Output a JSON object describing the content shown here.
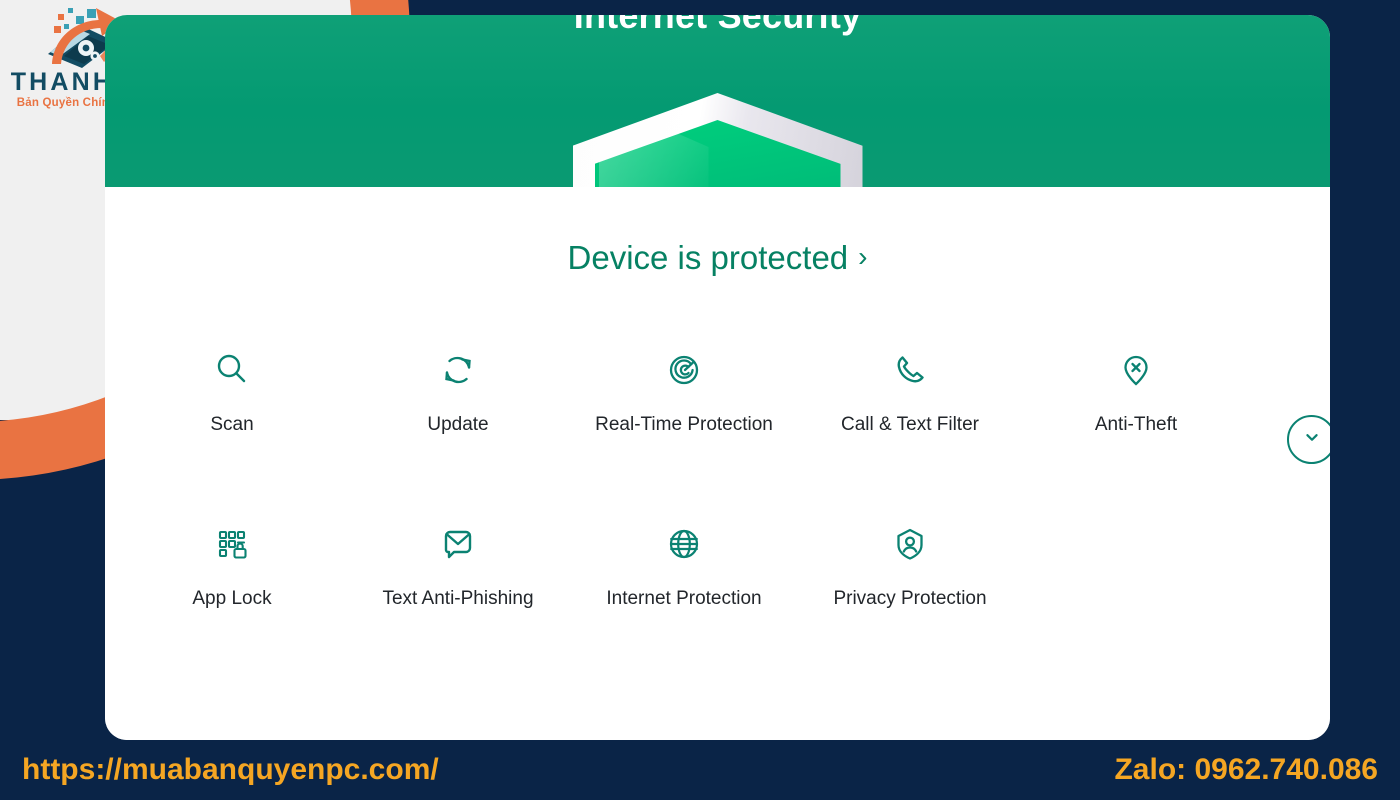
{
  "brand": {
    "logo_wordmark": "THANHPC",
    "logo_tagline": "Bản Quyền Chính Hãng",
    "logo_icon": "laptop-gear-arrow-icon",
    "colors": {
      "orange": "#e97342",
      "teal_dark": "#124c63",
      "navy": "#0a2447",
      "green": "#049a72",
      "amber": "#f5a623",
      "icon_teal": "#0b8272",
      "status_green": "#068163"
    }
  },
  "app": {
    "title": "Internet Security",
    "shield_icon": "shield-graphic",
    "status": {
      "label": "Device is protected",
      "chevron": "›"
    },
    "expand_button": {
      "icon": "chevron-down-icon"
    },
    "features": [
      {
        "label": "Scan",
        "icon": "magnifier-icon"
      },
      {
        "label": "Update",
        "icon": "refresh-icon"
      },
      {
        "label": "Real-Time Protection",
        "icon": "radar-target-icon"
      },
      {
        "label": "Call & Text Filter",
        "icon": "phone-icon"
      },
      {
        "label": "Anti-Theft",
        "icon": "map-pin-x-icon"
      },
      {
        "label": "App Lock",
        "icon": "app-grid-lock-icon"
      },
      {
        "label": "Text Anti-Phishing",
        "icon": "message-envelope-icon"
      },
      {
        "label": "Internet Protection",
        "icon": "globe-icon"
      },
      {
        "label": "Privacy Protection",
        "icon": "shield-person-icon"
      }
    ]
  },
  "footer": {
    "url": "https://muabanquyenpc.com/",
    "zalo": "Zalo: 0962.740.086"
  }
}
